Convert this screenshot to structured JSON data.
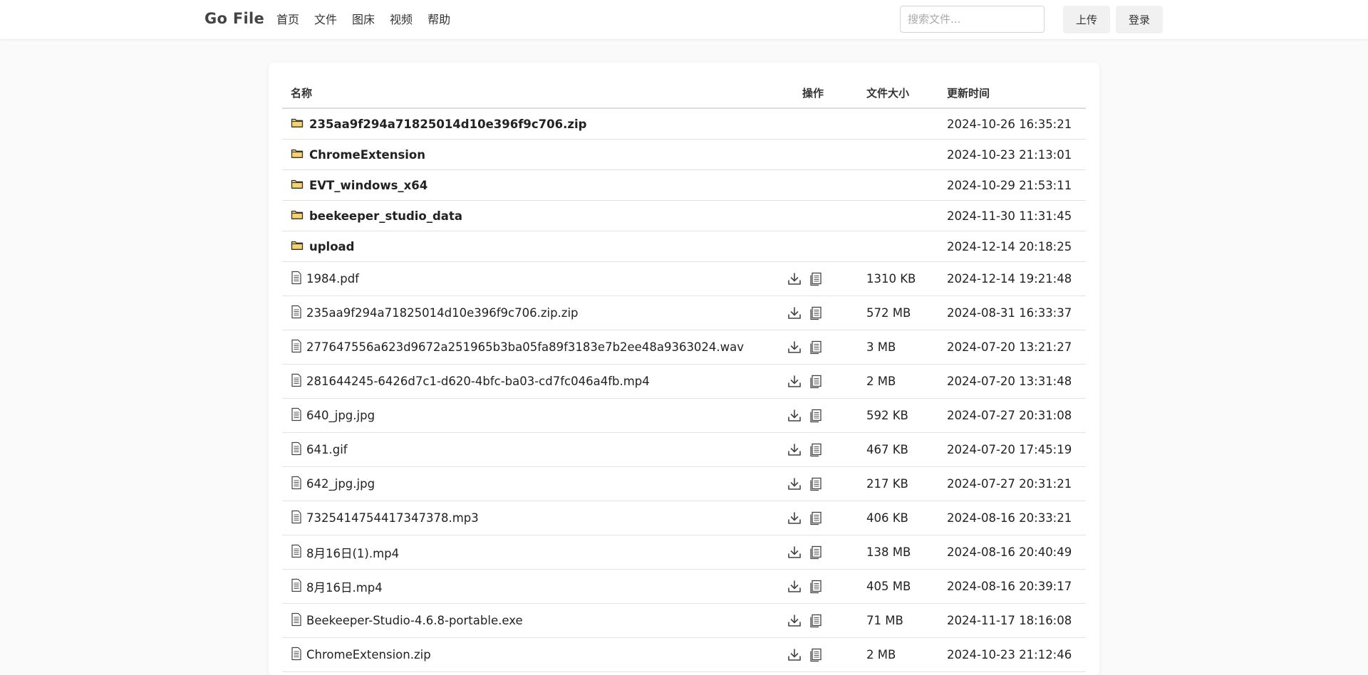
{
  "nav": {
    "brand": "Go File",
    "links": [
      "首页",
      "文件",
      "图床",
      "视频",
      "帮助"
    ],
    "search_placeholder": "搜索文件...",
    "upload_label": "上传",
    "login_label": "登录"
  },
  "table": {
    "headers": {
      "name": "名称",
      "ops": "操作",
      "size": "文件大小",
      "time": "更新时间"
    },
    "folders": [
      {
        "name": "235aa9f294a71825014d10e396f9c706.zip",
        "time": "2024-10-26 16:35:21"
      },
      {
        "name": "ChromeExtension",
        "time": "2024-10-23 21:13:01"
      },
      {
        "name": "EVT_windows_x64",
        "time": "2024-10-29 21:53:11"
      },
      {
        "name": "beekeeper_studio_data",
        "time": "2024-11-30 11:31:45"
      },
      {
        "name": "upload",
        "time": "2024-12-14 20:18:25"
      }
    ],
    "files": [
      {
        "name": "1984.pdf",
        "size": "1310 KB",
        "time": "2024-12-14 19:21:48"
      },
      {
        "name": "235aa9f294a71825014d10e396f9c706.zip.zip",
        "size": "572 MB",
        "time": "2024-08-31 16:33:37"
      },
      {
        "name": "277647556a623d9672a251965b3ba05fa89f3183e7b2ee48a9363024.wav",
        "size": "3 MB",
        "time": "2024-07-20 13:21:27"
      },
      {
        "name": "281644245-6426d7c1-d620-4bfc-ba03-cd7fc046a4fb.mp4",
        "size": "2 MB",
        "time": "2024-07-20 13:31:48"
      },
      {
        "name": "640_jpg.jpg",
        "size": "592 KB",
        "time": "2024-07-27 20:31:08"
      },
      {
        "name": "641.gif",
        "size": "467 KB",
        "time": "2024-07-20 17:45:19"
      },
      {
        "name": "642_jpg.jpg",
        "size": "217 KB",
        "time": "2024-07-27 20:31:21"
      },
      {
        "name": "7325414754417347378.mp3",
        "size": "406 KB",
        "time": "2024-08-16 20:33:21"
      },
      {
        "name": "8月16日(1).mp4",
        "size": "138 MB",
        "time": "2024-08-16 20:40:49"
      },
      {
        "name": "8月16日.mp4",
        "size": "405 MB",
        "time": "2024-08-16 20:39:17"
      },
      {
        "name": "Beekeeper-Studio-4.6.8-portable.exe",
        "size": "71 MB",
        "time": "2024-11-17 18:16:08"
      },
      {
        "name": "ChromeExtension.zip",
        "size": "2 MB",
        "time": "2024-10-23 21:12:46"
      }
    ]
  },
  "icons": {
    "folder": "folder-icon",
    "file": "file-icon",
    "download": "download-icon",
    "copy": "copy-icon"
  },
  "colors": {
    "folder_fill": "#f6d36b",
    "folder_stroke": "#333333"
  }
}
